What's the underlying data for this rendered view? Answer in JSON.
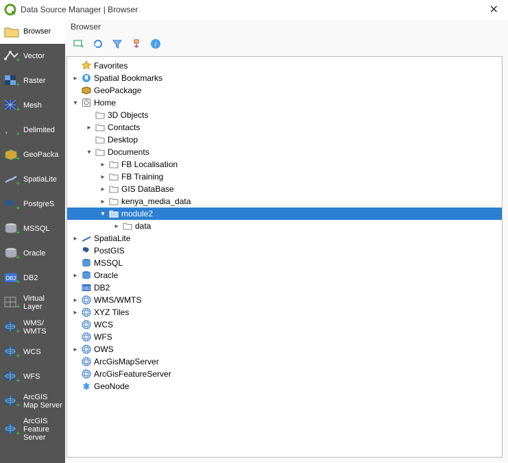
{
  "window": {
    "title": "Data Source Manager | Browser"
  },
  "sidebar": [
    {
      "id": "browser",
      "label": "Browser"
    },
    {
      "id": "vector",
      "label": "Vector"
    },
    {
      "id": "raster",
      "label": "Raster"
    },
    {
      "id": "mesh",
      "label": "Mesh"
    },
    {
      "id": "delimited",
      "label": "Delimited"
    },
    {
      "id": "geopackage",
      "label": "GeoPacka"
    },
    {
      "id": "spatialite",
      "label": "SpatiaLite"
    },
    {
      "id": "postgres",
      "label": "PostgreS"
    },
    {
      "id": "mssql",
      "label": "MSSQL"
    },
    {
      "id": "oracle",
      "label": "Oracle"
    },
    {
      "id": "db2",
      "label": "DB2"
    },
    {
      "id": "virtuallayer",
      "label": "Virtual Layer"
    },
    {
      "id": "wmswmts",
      "label": "WMS/ WMTS"
    },
    {
      "id": "wcs",
      "label": "WCS"
    },
    {
      "id": "wfs",
      "label": "WFS"
    },
    {
      "id": "arcgismap",
      "label": "ArcGIS Map Server"
    },
    {
      "id": "arcgisfeature",
      "label": "ArcGIS Feature Server"
    }
  ],
  "panel_title": "Browser",
  "tree": [
    {
      "d": 0,
      "a": "n",
      "icon": "star",
      "label": "Favorites"
    },
    {
      "d": 0,
      "a": "c",
      "icon": "bookmark",
      "label": "Spatial Bookmarks"
    },
    {
      "d": 0,
      "a": "n",
      "icon": "geopkg",
      "label": "GeoPackage"
    },
    {
      "d": 0,
      "a": "o",
      "icon": "home",
      "label": "Home"
    },
    {
      "d": 1,
      "a": "n",
      "icon": "folder",
      "label": "3D Objects"
    },
    {
      "d": 1,
      "a": "c",
      "icon": "folder",
      "label": "Contacts"
    },
    {
      "d": 1,
      "a": "n",
      "icon": "folder",
      "label": "Desktop"
    },
    {
      "d": 1,
      "a": "o",
      "icon": "folder",
      "label": "Documents"
    },
    {
      "d": 2,
      "a": "c",
      "icon": "folder",
      "label": "FB Localisation"
    },
    {
      "d": 2,
      "a": "c",
      "icon": "folder",
      "label": "FB Training"
    },
    {
      "d": 2,
      "a": "c",
      "icon": "folder",
      "label": "GIS DataBase"
    },
    {
      "d": 2,
      "a": "c",
      "icon": "folder",
      "label": "kenya_media_data"
    },
    {
      "d": 2,
      "a": "o",
      "icon": "folder-sel",
      "label": "module2",
      "selected": true
    },
    {
      "d": 3,
      "a": "c",
      "icon": "folder",
      "label": "data"
    },
    {
      "d": 0,
      "a": "c",
      "icon": "spatialite",
      "label": "SpatiaLite"
    },
    {
      "d": 0,
      "a": "n",
      "icon": "postgis",
      "label": "PostGIS"
    },
    {
      "d": 0,
      "a": "n",
      "icon": "mssql",
      "label": "MSSQL"
    },
    {
      "d": 0,
      "a": "c",
      "icon": "oracle",
      "label": "Oracle"
    },
    {
      "d": 0,
      "a": "n",
      "icon": "db2",
      "label": "DB2"
    },
    {
      "d": 0,
      "a": "c",
      "icon": "globe",
      "label": "WMS/WMTS"
    },
    {
      "d": 0,
      "a": "c",
      "icon": "globe",
      "label": "XYZ Tiles"
    },
    {
      "d": 0,
      "a": "n",
      "icon": "globe",
      "label": "WCS"
    },
    {
      "d": 0,
      "a": "n",
      "icon": "globe",
      "label": "WFS"
    },
    {
      "d": 0,
      "a": "c",
      "icon": "globe",
      "label": "OWS"
    },
    {
      "d": 0,
      "a": "n",
      "icon": "globe",
      "label": "ArcGisMapServer"
    },
    {
      "d": 0,
      "a": "n",
      "icon": "globe",
      "label": "ArcGisFeatureServer"
    },
    {
      "d": 0,
      "a": "n",
      "icon": "geonode",
      "label": "GeoNode"
    }
  ]
}
